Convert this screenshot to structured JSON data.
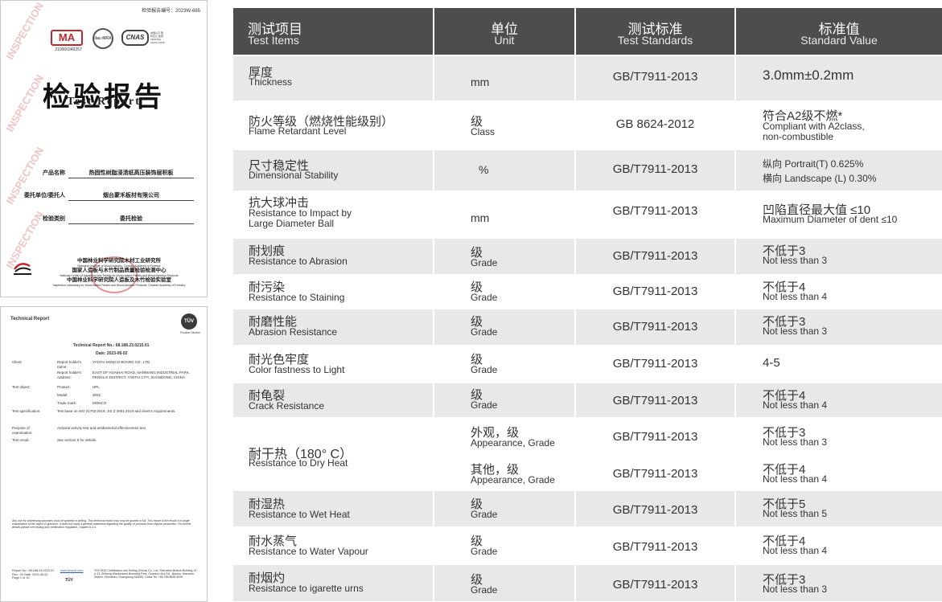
{
  "doc1": {
    "report_number": "检验报告编号：2023W-665",
    "logo_ma": "MA",
    "logo_ma_number": "210000349257",
    "logo_ilac": "ilac-MRA",
    "logo_cnas": "CNAS",
    "logo_cnas_side": "中国认可 国际互认 检测 TESTING CNAS L3446",
    "title_zh": "检验报告",
    "title_en": "Test Report",
    "fields": [
      {
        "label": "产品名称",
        "value": "热固性树脂浸渍纸高压装饰层积板"
      },
      {
        "label": "委托单位/委托人",
        "value": "烟台蒙禾板材有限公司"
      },
      {
        "label": "检验类别",
        "value": "委托检验"
      }
    ],
    "org_lines": [
      "中国林业科学研究院木材工业研究所",
      "Research Institute of Wood Industry, Chinese Academy of Forestry",
      "国家人造板与木竹制品质量检验检测中心",
      "National Center of Inspection and Testing for Wood-based Panels and Wood-bamboo Products",
      "中国林业科学研究院人造板及木竹检验实验室",
      "Inspection Laboratory for Wood-based Panels and Wood-bamboo Products, Chinese Academy of Forestry"
    ]
  },
  "doc2": {
    "header": "Technical Report",
    "tuv": "TÜV",
    "tuv_sub": "Product Service",
    "report_no": "Technical Report No.: 68.188.23.0215.01",
    "date": "Date: 2023-06-02",
    "client_label": "Client:",
    "holder_name_label": "Report holder's name:",
    "holder_name": "YANTAI MONCO BOARD CO., LTD",
    "holder_addr_label": "Report holder's Address:",
    "holder_addr": "EAST OF HUAIHAI ROAD, NANWANG INDUSTRIAL PARK, PENGLAI DISTRICT, YANTAI CITY, SHANDONG, CHINA",
    "test_object_label": "Test object:",
    "product_label": "Product:",
    "product": "HPL",
    "model_label": "Model:",
    "model": "3032",
    "trademark_label": "Trade mark:",
    "trademark": "MONCO",
    "spec_label": "Test specification:",
    "spec": "Test base on ISO 21702:2019, JIS Z 2801:2010 and client's requirements.",
    "purpose_label": "Purpose of examination:",
    "purpose": "Antiviral activity test and antibacterial effectiveness test.",
    "result_label": "Test result:",
    "result": "See section 6 for details.",
    "disclaimer": "Any use for advertising purposes must be granted in writing. This technical report may only be quoted in full. This report is the result of a single examination of the object in question. It does not imply a general statement regarding the quality of products from regular production. For further details please see testing and certification regulation, chapter A-3.4.",
    "footer_left": "Report No.: 68.188.23.0215.01 Rev.: 00 Date: 2023-06-02 Page 1 of 10",
    "footer_link": "www.tuvsud.com",
    "footer_right": "TÜV SÜD Certification and Testing (China) Co., Ltd. Shenzhen Branch Building 12 & 13, Zhiheng Wisdomland Business Park, Guankou 2nd Rd., Nantou, Nanshan District, Shenzhen, Guangdong 518052, China Tel: +86 755 8828 8399"
  },
  "table": {
    "headers": [
      {
        "zh": "测试项目",
        "en": "Test Items"
      },
      {
        "zh": "单位",
        "en": "Unit"
      },
      {
        "zh": "测试标准",
        "en": "Test Standards"
      },
      {
        "zh": "标准值",
        "en": "Standard Value"
      }
    ],
    "rows": [
      {
        "item_zh": "厚度",
        "item_en": "Thickness",
        "unit": "mm",
        "std": "GB/T7911-2013",
        "val_big": "3.0mm±0.2mm"
      },
      {
        "item_zh": "防火等级（燃烧性能级别）",
        "item_en": "Flame Retardant Level",
        "unit_zh": "级",
        "unit_en": "Class",
        "std": "GB 8624-2012",
        "val_zh": "符合A2级不燃*",
        "val_en1": "Compliant with A2class,",
        "val_en2": "non-combustible"
      },
      {
        "item_zh": "尺寸稳定性",
        "item_en": "Dimensional Stability",
        "unit": "%",
        "std": "GB/T7911-2013",
        "val_line1": "纵向   Portrait(T) 0.625%",
        "val_line2": "横向   Landscape (L) 0.30%"
      },
      {
        "item_zh": "抗大球冲击",
        "item_en1": "Resistance to Impact by",
        "item_en2": "Large Diameter Ball",
        "unit": "mm",
        "std": "GB/T7911-2013",
        "val_zh": "凹陷直径最大值 ≤10",
        "val_en": "Maximum Diameter of dent ≤10"
      },
      {
        "item_zh": "耐划痕",
        "item_en": "Resistance to Abrasion",
        "unit_zh": "级",
        "unit_en": "Grade",
        "std": "GB/T7911-2013",
        "val_zh": "不低于3",
        "val_en": "Not less than 3"
      },
      {
        "item_zh": "耐污染",
        "item_en": "Resistance to Staining",
        "unit_zh": "级",
        "unit_en": "Grade",
        "std": "GB/T7911-2013",
        "val_zh": "不低于4",
        "val_en": "Not less than 4"
      },
      {
        "item_zh": "耐磨性能",
        "item_en": "Abrasion Resistance",
        "unit_zh": "级",
        "unit_en": "Grade",
        "std": "GB/T7911-2013",
        "val_zh": "不低于3",
        "val_en": "Not less than 3"
      },
      {
        "item_zh": "耐光色牢度",
        "item_en": "Color fastness to Light",
        "unit_zh": "级",
        "unit_en": "Grade",
        "std": "GB/T7911-2013",
        "val_big": "4-5"
      },
      {
        "item_zh": "耐龟裂",
        "item_en": "Crack Resistance",
        "unit_zh": "级",
        "unit_en": "Grade",
        "std": "GB/T7911-2013",
        "val_zh": "不低于4",
        "val_en": "Not less than 4"
      },
      {
        "item_zh": "耐干热（180° C）",
        "item_en": "Resistance to Dry Heat",
        "sub": [
          {
            "unit_zh": "外观，级",
            "unit_en": "Appearance, Grade",
            "std": "GB/T7911-2013",
            "val_zh": "不低于3",
            "val_en": "Not less than 3"
          },
          {
            "unit_zh": "其他，级",
            "unit_en": "Appearance, Grade",
            "std": "GB/T7911-2013",
            "val_zh": "不低于4",
            "val_en": "Not less than 4"
          }
        ]
      },
      {
        "item_zh": "耐湿热",
        "item_en": "Resistance to Wet Heat",
        "unit_zh": "级",
        "unit_en": "Grade",
        "std": "GB/T7911-2013",
        "val_zh": "不低于5",
        "val_en": "Not less than 5"
      },
      {
        "item_zh": "耐水蒸气",
        "item_en": "Resistance to Water Vapour",
        "unit_zh": "级",
        "unit_en": "Grade",
        "std": "GB/T7911-2013",
        "val_zh": "不低于4",
        "val_en": "Not less than 4"
      },
      {
        "item_zh": "耐烟灼",
        "item_en": "Resistance to  igarette  urns",
        "unit_zh": "级",
        "unit_en": "Grade",
        "std": "GB/T7911-2013",
        "val_zh": "不低于3",
        "val_en": "Not less than 3"
      }
    ]
  },
  "colors": {
    "header_bg": "#4d4d4d",
    "row_alt": "#e8e8e8",
    "stamp_red": "#c0282d"
  }
}
